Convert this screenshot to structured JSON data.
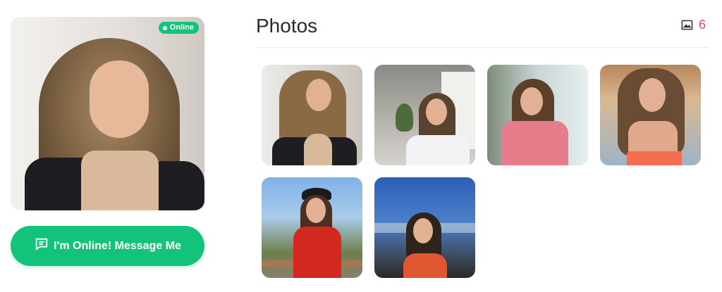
{
  "profile": {
    "status_badge": "Online",
    "photo_alt": "Profile photo"
  },
  "actions": {
    "message_label": "I'm Online! Message Me"
  },
  "photos": {
    "title": "Photos",
    "count": "6",
    "icon": "image-icon",
    "items": [
      {
        "label": "photo-1"
      },
      {
        "label": "photo-2"
      },
      {
        "label": "photo-3"
      },
      {
        "label": "photo-4"
      },
      {
        "label": "photo-5"
      },
      {
        "label": "photo-6"
      }
    ]
  },
  "colors": {
    "accent_green": "#13c37b",
    "count_pink": "#e3407e"
  }
}
